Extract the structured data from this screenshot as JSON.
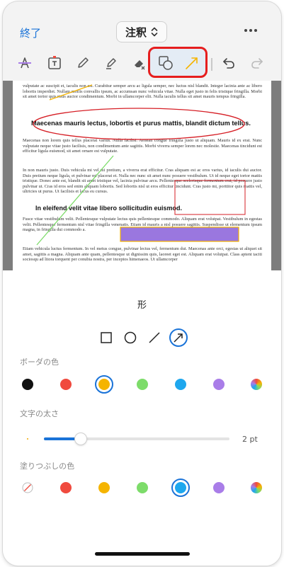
{
  "nav": {
    "done_label": "終了",
    "mode_label": "注釈"
  },
  "toolbar": {
    "tools": [
      "strikethrough-icon",
      "text-box-icon",
      "pen-icon",
      "highlighter-icon",
      "eraser-icon",
      "shape-icon",
      "line-arrow-icon",
      "undo-icon",
      "redo-icon"
    ],
    "active_tool": "shape-icon"
  },
  "document": {
    "para1": "vulputate ac suscipit et, iaculis non est. Curabitur semper arcu ac ligula semper, nec luctus nisl blandit. Integer lacinia ante ac libero lobortis imperdiet. Nullam mollis convallis ipsum, ac accumsan nunc vehicula vitae. Nulla eget justo in felis tristique fringilla. Morbi sit amet tortor quis risus auctor condimentum. Morbi in ullamcorper elit. Nulla iaculis tellus sit amet mauris tempus fringilla.",
    "heading1": "Maecenas mauris lectus, lobortis et purus mattis, blandit dictum tellus.",
    "para2": "Maecenas non lorem quis tellus placerat varius. Nulla facilisi. Aenean congue fringilla justo ut aliquam. Mauris id ex erat. Nunc vulputate neque vitae justo facilisis, non condimentum ante sagittis. Morbi viverra semper lorem nec molestie. Maecenas tincidunt est efficitur ligula euismod, sit amet ornare est vulputate.",
    "para3": "In non mauris justo. Duis vehicula mi vel mi pretium, a viverra erat efficitur. Cras aliquam est ac eros varius, id iaculis dui auctor. Duis pretium neque ligula, et pulvinar mi placerat et. Nulla nec nunc sit amet nunc posuere vestibulum. Ut id neque eget tortor mattis tristique. Donec ante est, blandit sit amet tristique vel, lacinia pulvinar arcu. Pellentesque scelerisque fermentum erat, id posuere justo pulvinar ut. Cras id eros sed enim aliquam lobortis. Sed lobortis nisl ut eros efficitur tincidunt. Cras justo mi, porttitor quis mattis vel, ultricies ut purus. Ut facilisis et lacus eu cursus.",
    "heading2": "In eleifend velit vitae libero sollicitudin euismod.",
    "para4": "Fusce vitae vestibulum velit. Pellentesque vulputate lectus quis pellentesque commodo. Aliquam erat volutpat. Vestibulum in egestas velit. Pellentesque fermentum nisl vitae fringilla venenatis. Etiam id mauris a nisl posuere sagittis. Suspendisse ut elementum ipsum magna, in fringilla dui commodo a.",
    "para5": "Etiam vehicula luctus fermentum. In vel metus congue, pulvinar lectus vel, fermentum dui. Maecenas ante orci, egestas ut aliquet sit amet, sagittis a magna. Aliquam ante quam, pellentesque ut dignissim quis, laoreet eget est. Aliquam erat volutpat. Class aptent taciti sociosqu ad litora torquent per conubia nostra, per inceptos himenaeos. Ut ullamcorper"
  },
  "sheet": {
    "title": "形",
    "shapes": [
      "rectangle-icon",
      "circle-icon",
      "line-icon",
      "arrow-icon"
    ],
    "selected_shape": "arrow-icon",
    "border_color_label": "ボーダの色",
    "border_colors": [
      "#111111",
      "#f04a3e",
      "#f5b400",
      "#7ddc6a",
      "#1ea7ee",
      "#a97de8",
      "rainbow"
    ],
    "selected_border_color": "#f5b400",
    "stroke_label": "文字の太さ",
    "stroke_value": 2,
    "stroke_max": 10,
    "stroke_value_label": "2 pt",
    "fill_color_label": "塗りつぶしの色",
    "fill_colors": [
      "none",
      "#f04a3e",
      "#f5b400",
      "#7ddc6a",
      "#1ea7ee",
      "#a97de8",
      "rainbow"
    ],
    "selected_fill_color": "#1ea7ee"
  }
}
